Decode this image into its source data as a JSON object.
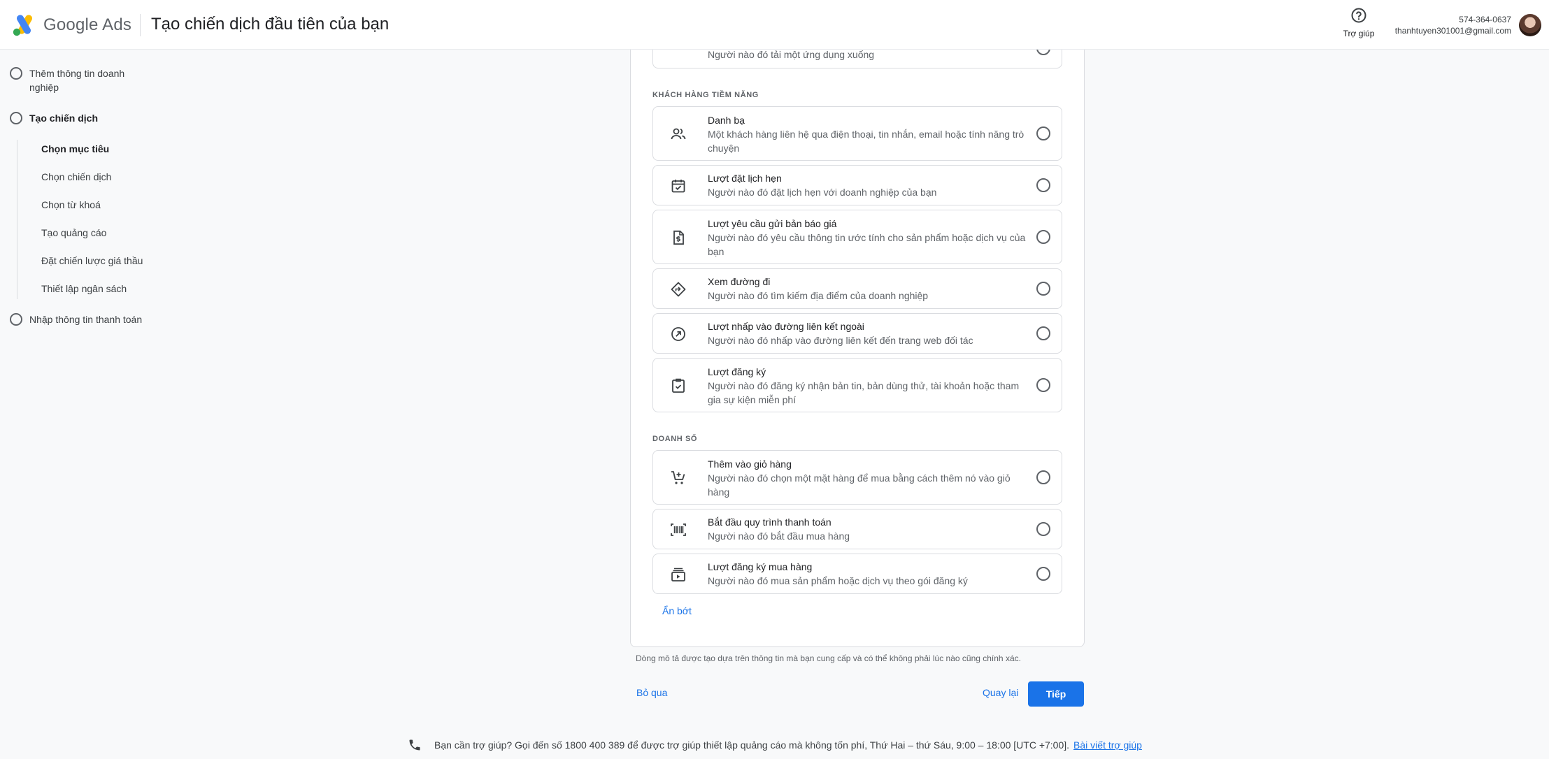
{
  "header": {
    "brand": "Google Ads",
    "title": "Tạo chiến dịch đầu tiên của bạn",
    "help_label": "Trợ giúp",
    "phone": "574-364-0637",
    "email": "thanhtuyen301001@gmail.com"
  },
  "sidebar": {
    "steps": [
      {
        "label": "Thêm thông tin doanh nghiệp"
      },
      {
        "label": "Tạo chiến dịch"
      },
      {
        "label": "Nhập thông tin thanh toán"
      }
    ],
    "substeps": [
      {
        "label": "Chọn mục tiêu"
      },
      {
        "label": "Chọn chiến dịch"
      },
      {
        "label": "Chọn từ khoá"
      },
      {
        "label": "Tạo quảng cáo"
      },
      {
        "label": "Đặt chiến lược giá thầu"
      },
      {
        "label": "Thiết lập ngân sách"
      }
    ]
  },
  "main": {
    "top_partial_desc": "Người nào đó tải một ứng dụng xuống",
    "sections": {
      "leads": "KHÁCH HÀNG TIỀM NĂNG",
      "sales": "DOANH SỐ"
    },
    "options": [
      {
        "title": "Danh bạ",
        "desc": "Một khách hàng liên hệ qua điện thoại, tin nhắn, email hoặc tính năng trò chuyện",
        "icon": "contacts-icon"
      },
      {
        "title": "Lượt đặt lịch hẹn",
        "desc": "Người nào đó đặt lịch hẹn với doanh nghiệp của bạn",
        "icon": "calendar-check-icon"
      },
      {
        "title": "Lượt yêu cầu gửi bản báo giá",
        "desc": "Người nào đó yêu cầu thông tin ước tính cho sản phẩm hoặc dịch vụ của bạn",
        "icon": "request-quote-icon"
      },
      {
        "title": "Xem đường đi",
        "desc": "Người nào đó tìm kiếm địa điểm của doanh nghiệp",
        "icon": "directions-icon"
      },
      {
        "title": "Lượt nhấp vào đường liên kết ngoài",
        "desc": "Người nào đó nhấp vào đường liên kết đến trang web đối tác",
        "icon": "outbound-link-icon"
      },
      {
        "title": "Lượt đăng ký",
        "desc": "Người nào đó đăng ký nhận bản tin, bản dùng thử, tài khoản hoặc tham gia sự kiện miễn phí",
        "icon": "signup-check-icon"
      },
      {
        "title": "Thêm vào giỏ hàng",
        "desc": "Người nào đó chọn một mặt hàng để mua bằng cách thêm nó vào giỏ hàng",
        "icon": "add-cart-icon"
      },
      {
        "title": "Bắt đầu quy trình thanh toán",
        "desc": "Người nào đó bắt đầu mua hàng",
        "icon": "barcode-icon"
      },
      {
        "title": "Lượt đăng ký mua hàng",
        "desc": "Người nào đó mua sản phẩm hoặc dịch vụ theo gói đăng ký",
        "icon": "subscription-icon"
      }
    ],
    "show_less": "Ẩn bớt",
    "disclaimer": "Dòng mô tả được tạo dựa trên thông tin mà bạn cung cấp và có thể không phải lúc nào cũng chính xác.",
    "skip": "Bỏ qua",
    "back": "Quay lại",
    "next": "Tiếp"
  },
  "footer": {
    "text": "Bạn cần trợ giúp? Gọi đến số 1800 400 389 để được trợ giúp thiết lập quảng cáo mà không tốn phí, Thứ Hai – thứ Sáu, 9:00 – 18:00 [UTC +7:00].",
    "link": "Bài viết trợ giúp"
  },
  "colors": {
    "accent": "#1a73e8",
    "text": "#202124",
    "muted": "#5f6368",
    "border": "#dadce0"
  }
}
